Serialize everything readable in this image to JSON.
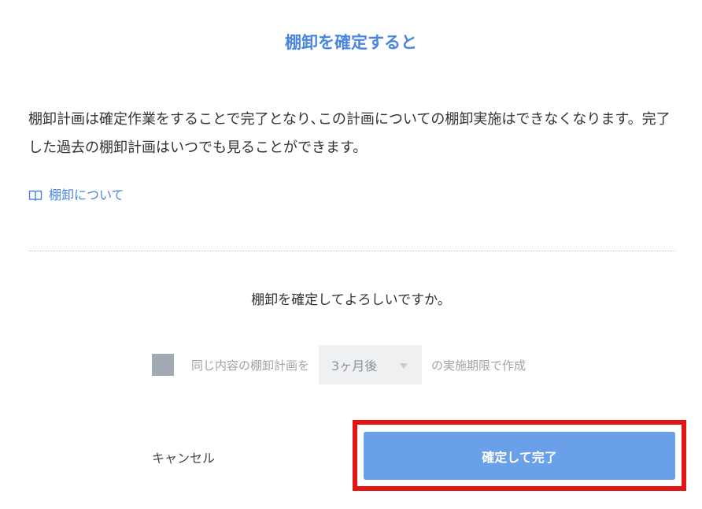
{
  "dialog": {
    "title": "棚卸を確定すると",
    "description": "棚卸計画は確定作業をすることで完了となり､この計画についての棚卸実施はできなくなります。完了した過去の棚卸計画はいつでも見ることができます。",
    "help_link": {
      "icon": "book-icon",
      "label": "棚卸について"
    },
    "question": "棚卸を確定してよろしいですか。",
    "repeat_option": {
      "checked": true,
      "prefix": "同じ内容の棚卸計画を",
      "select_value": "3ヶ月後",
      "suffix": "の実施期限で作成"
    },
    "cancel_label": "キャンセル",
    "confirm_label": "確定して完了"
  },
  "colors": {
    "accent": "#4a86e0",
    "confirm_button": "#6aa0ea",
    "highlight": "#e31414",
    "checkbox": "#a2abb4"
  }
}
